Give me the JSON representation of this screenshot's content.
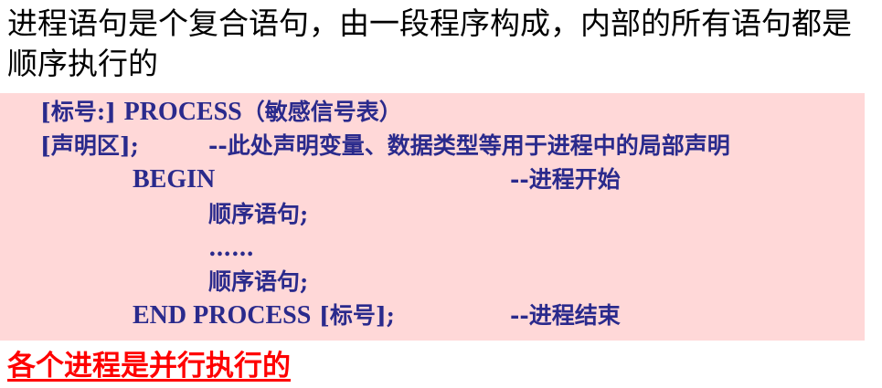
{
  "intro": {
    "text": "进程语句是个复合语句，由一段程序构成，内部的所有语句都是顺序执行的"
  },
  "code": {
    "line1_label": "[标号:]",
    "line1_keyword": "PROCESS",
    "line1_sensitivity": "（敏感信号表）",
    "line2_decl": "[声明区];",
    "line2_comment": "--此处声明变量、数据类型等用于进程中的局部声明",
    "line3_keyword": "BEGIN",
    "line3_comment": "--进程开始",
    "line4_stmt": "顺序语句;",
    "line5_ellipsis": "……",
    "line6_stmt": "顺序语句;",
    "line7_keyword": "END PROCESS",
    "line7_label": "[标号];",
    "line7_comment": "--进程结束"
  },
  "footer": {
    "text": "各个进程是并行执行的"
  },
  "colors": {
    "code_background": "#ffd8d8",
    "code_text": "#2a2a8c",
    "footer_text": "#ff0000"
  }
}
